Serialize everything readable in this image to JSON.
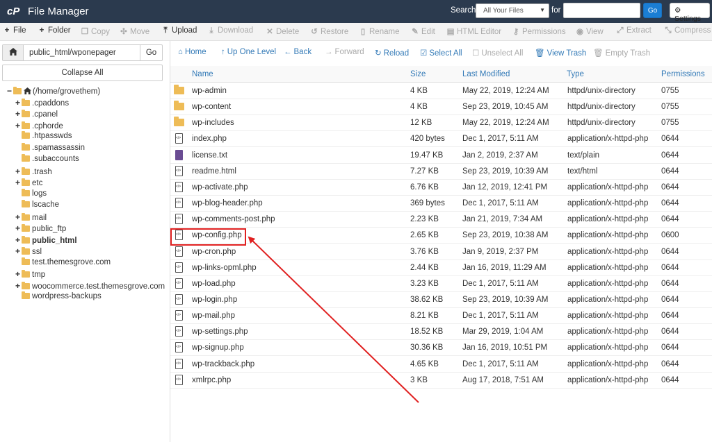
{
  "header": {
    "title": "File Manager",
    "search_label": "Search",
    "search_scope": "All Your Files",
    "for_label": "for",
    "search_placeholder": "",
    "go_label": "Go",
    "settings_label": "Settings"
  },
  "toolbar": {
    "file": "File",
    "folder": "Folder",
    "copy": "Copy",
    "move": "Move",
    "upload": "Upload",
    "download": "Download",
    "delete": "Delete",
    "restore": "Restore",
    "rename": "Rename",
    "edit": "Edit",
    "html_editor": "HTML Editor",
    "permissions": "Permissions",
    "view": "View",
    "extract": "Extract",
    "compress": "Compress"
  },
  "sidebar": {
    "path": "public_html/wponepager",
    "go_label": "Go",
    "collapse_label": "Collapse All",
    "tree": [
      {
        "label": "(/home/grovethem)",
        "toggle": "−",
        "root": true
      },
      {
        "label": ".cpaddons",
        "toggle": "+"
      },
      {
        "label": ".cpanel",
        "toggle": "+"
      },
      {
        "label": ".cphorde",
        "toggle": "+"
      },
      {
        "label": ".htpasswds",
        "toggle": ""
      },
      {
        "label": ".spamassassin",
        "toggle": ""
      },
      {
        "label": ".subaccounts",
        "toggle": ""
      },
      {
        "label": ".trash",
        "toggle": "+"
      },
      {
        "label": "etc",
        "toggle": "+"
      },
      {
        "label": "logs",
        "toggle": ""
      },
      {
        "label": "lscache",
        "toggle": ""
      },
      {
        "label": "mail",
        "toggle": "+"
      },
      {
        "label": "public_ftp",
        "toggle": "+"
      },
      {
        "label": "public_html",
        "toggle": "+",
        "bold": true
      },
      {
        "label": "ssl",
        "toggle": "+"
      },
      {
        "label": "test.themesgrove.com",
        "toggle": ""
      },
      {
        "label": "tmp",
        "toggle": "+"
      },
      {
        "label": "woocommerce.test.themesgrove.com",
        "toggle": "+"
      },
      {
        "label": "wordpress-backups",
        "toggle": ""
      }
    ]
  },
  "nav": {
    "home": "Home",
    "up": "Up One Level",
    "back": "Back",
    "forward": "Forward",
    "reload": "Reload",
    "select_all": "Select All",
    "unselect_all": "Unselect All",
    "view_trash": "View Trash",
    "empty_trash": "Empty Trash"
  },
  "table": {
    "columns": {
      "name": "Name",
      "size": "Size",
      "modified": "Last Modified",
      "type": "Type",
      "permissions": "Permissions"
    },
    "rows": [
      {
        "icon": "folder",
        "name": "wp-admin",
        "size": "4 KB",
        "modified": "May 22, 2019, 12:24 AM",
        "type": "httpd/unix-directory",
        "perm": "0755"
      },
      {
        "icon": "folder",
        "name": "wp-content",
        "size": "4 KB",
        "modified": "Sep 23, 2019, 10:45 AM",
        "type": "httpd/unix-directory",
        "perm": "0755"
      },
      {
        "icon": "folder",
        "name": "wp-includes",
        "size": "12 KB",
        "modified": "May 22, 2019, 12:24 AM",
        "type": "httpd/unix-directory",
        "perm": "0755"
      },
      {
        "icon": "php",
        "name": "index.php",
        "size": "420 bytes",
        "modified": "Dec 1, 2017, 5:11 AM",
        "type": "application/x-httpd-php",
        "perm": "0644"
      },
      {
        "icon": "text",
        "name": "license.txt",
        "size": "19.47 KB",
        "modified": "Jan 2, 2019, 2:37 AM",
        "type": "text/plain",
        "perm": "0644"
      },
      {
        "icon": "php",
        "name": "readme.html",
        "size": "7.27 KB",
        "modified": "Sep 23, 2019, 10:39 AM",
        "type": "text/html",
        "perm": "0644"
      },
      {
        "icon": "php",
        "name": "wp-activate.php",
        "size": "6.76 KB",
        "modified": "Jan 12, 2019, 12:41 PM",
        "type": "application/x-httpd-php",
        "perm": "0644"
      },
      {
        "icon": "php",
        "name": "wp-blog-header.php",
        "size": "369 bytes",
        "modified": "Dec 1, 2017, 5:11 AM",
        "type": "application/x-httpd-php",
        "perm": "0644"
      },
      {
        "icon": "php",
        "name": "wp-comments-post.php",
        "size": "2.23 KB",
        "modified": "Jan 21, 2019, 7:34 AM",
        "type": "application/x-httpd-php",
        "perm": "0644"
      },
      {
        "icon": "php",
        "name": "wp-config.php",
        "size": "2.65 KB",
        "modified": "Sep 23, 2019, 10:38 AM",
        "type": "application/x-httpd-php",
        "perm": "0600"
      },
      {
        "icon": "php",
        "name": "wp-cron.php",
        "size": "3.76 KB",
        "modified": "Jan 9, 2019, 2:37 PM",
        "type": "application/x-httpd-php",
        "perm": "0644"
      },
      {
        "icon": "php",
        "name": "wp-links-opml.php",
        "size": "2.44 KB",
        "modified": "Jan 16, 2019, 11:29 AM",
        "type": "application/x-httpd-php",
        "perm": "0644"
      },
      {
        "icon": "php",
        "name": "wp-load.php",
        "size": "3.23 KB",
        "modified": "Dec 1, 2017, 5:11 AM",
        "type": "application/x-httpd-php",
        "perm": "0644"
      },
      {
        "icon": "php",
        "name": "wp-login.php",
        "size": "38.62 KB",
        "modified": "Sep 23, 2019, 10:39 AM",
        "type": "application/x-httpd-php",
        "perm": "0644"
      },
      {
        "icon": "php",
        "name": "wp-mail.php",
        "size": "8.21 KB",
        "modified": "Dec 1, 2017, 5:11 AM",
        "type": "application/x-httpd-php",
        "perm": "0644"
      },
      {
        "icon": "php",
        "name": "wp-settings.php",
        "size": "18.52 KB",
        "modified": "Mar 29, 2019, 1:04 AM",
        "type": "application/x-httpd-php",
        "perm": "0644"
      },
      {
        "icon": "php",
        "name": "wp-signup.php",
        "size": "30.36 KB",
        "modified": "Jan 16, 2019, 10:51 PM",
        "type": "application/x-httpd-php",
        "perm": "0644"
      },
      {
        "icon": "php",
        "name": "wp-trackback.php",
        "size": "4.65 KB",
        "modified": "Dec 1, 2017, 5:11 AM",
        "type": "application/x-httpd-php",
        "perm": "0644"
      },
      {
        "icon": "php",
        "name": "xmlrpc.php",
        "size": "3 KB",
        "modified": "Aug 17, 2018, 7:51 AM",
        "type": "application/x-httpd-php",
        "perm": "0644"
      }
    ]
  },
  "colors": {
    "header_bg": "#2b3a4e",
    "link": "#337ab7",
    "folder": "#eebc57",
    "annotation": "#e02020"
  }
}
